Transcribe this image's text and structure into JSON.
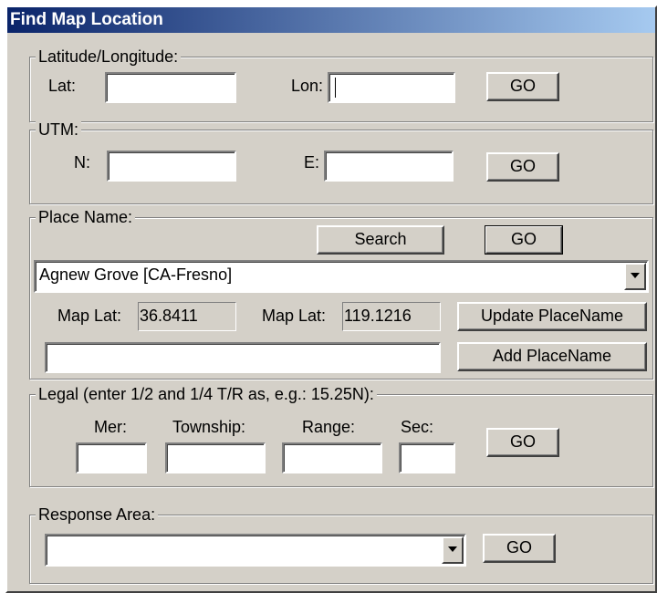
{
  "window": {
    "title": "Find Map Location"
  },
  "latlon": {
    "legend": "Latitude/Longitude:",
    "lat_label": "Lat:",
    "lat_value": "",
    "lon_label": "Lon:",
    "lon_value": "",
    "go_label": "GO"
  },
  "utm": {
    "legend": "UTM:",
    "n_label": "N:",
    "n_value": "",
    "e_label": "E:",
    "e_value": "",
    "go_label": "GO"
  },
  "place": {
    "legend": "Place Name:",
    "search_label": "Search",
    "go_label": "GO",
    "selected": "Agnew Grove [CA-Fresno]",
    "map_lat_label_1": "Map Lat:",
    "map_lat_value_1": "36.8411",
    "map_lat_label_2": "Map Lat:",
    "map_lat_value_2": "119.1216",
    "update_label": "Update PlaceName",
    "new_name_value": "",
    "add_label": "Add PlaceName"
  },
  "legal": {
    "legend": "Legal (enter 1/2 and 1/4 T/R as, e.g.: 15.25N):",
    "mer_label": "Mer:",
    "township_label": "Township:",
    "range_label": "Range:",
    "sec_label": "Sec:",
    "go_label": "GO"
  },
  "response": {
    "legend": "Response Area:",
    "selected": "",
    "go_label": "GO"
  },
  "icons": {
    "dropdown": "chevron-down-icon"
  }
}
